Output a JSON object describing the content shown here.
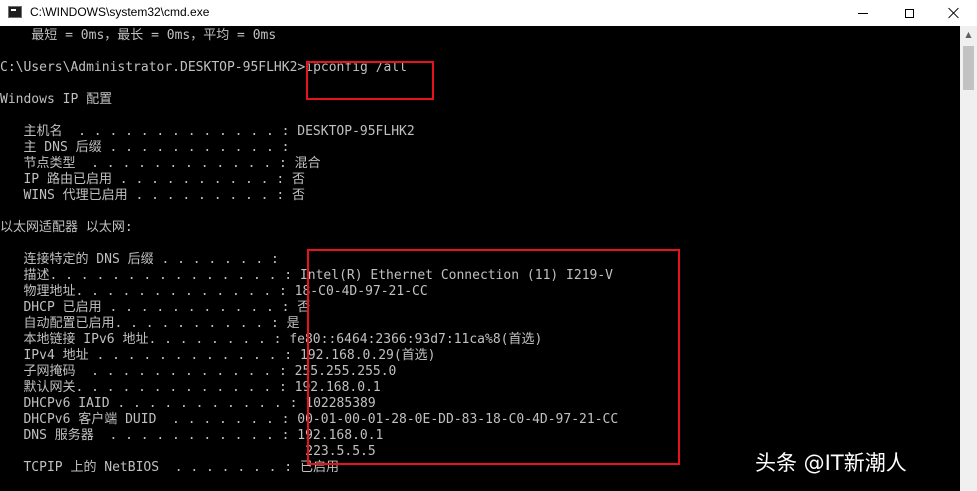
{
  "window": {
    "title": "C:\\WINDOWS\\system32\\cmd.exe",
    "icon": "cmd-icon",
    "controls": [
      "minimize-icon",
      "maximize-icon",
      "close-icon"
    ]
  },
  "console": {
    "ping_summary": "    最短 = 0ms，最长 = 0ms，平均 = 0ms",
    "prompt": "C:\\Users\\Administrator.DESKTOP-95FLHK2>",
    "command": "ipconfig /all",
    "section_ip": "Windows IP 配置",
    "ip_config": [
      {
        "label": "   主机名  . . . . . . . . . . . . . : ",
        "value": "DESKTOP-95FLHK2"
      },
      {
        "label": "   主 DNS 后缀 . . . . . . . . . . . : ",
        "value": ""
      },
      {
        "label": "   节点类型  . . . . . . . . . . . . : ",
        "value": "混合"
      },
      {
        "label": "   IP 路由已启用 . . . . . . . . . . : ",
        "value": "否"
      },
      {
        "label": "   WINS 代理已启用 . . . . . . . . . : ",
        "value": "否"
      }
    ],
    "section_adapter": "以太网适配器 以太网:",
    "adapter": [
      {
        "label": "   连接特定的 DNS 后缀 . . . . . . . : ",
        "value": ""
      },
      {
        "label": "   描述. . . . . . . . . . . . . . . : ",
        "value": "Intel(R) Ethernet Connection (11) I219-V"
      },
      {
        "label": "   物理地址. . . . . . . . . . . . . : ",
        "value": "18-C0-4D-97-21-CC"
      },
      {
        "label": "   DHCP 已启用 . . . . . . . . . . . : ",
        "value": "否"
      },
      {
        "label": "   自动配置已启用. . . . . . . . . . : ",
        "value": "是"
      },
      {
        "label": "   本地链接 IPv6 地址. . . . . . . . : ",
        "value": "fe80::6464:2366:93d7:11ca%8(首选)"
      },
      {
        "label": "   IPv4 地址 . . . . . . . . . . . . : ",
        "value": "192.168.0.29(首选)"
      },
      {
        "label": "   子网掩码  . . . . . . . . . . . . : ",
        "value": "255.255.255.0"
      },
      {
        "label": "   默认网关. . . . . . . . . . . . . : ",
        "value": "192.168.0.1"
      },
      {
        "label": "   DHCPv6 IAID . . . . . . . . . . . : ",
        "value": "102285389"
      },
      {
        "label": "   DHCPv6 客户端 DUID  . . . . . . . : ",
        "value": "00-01-00-01-28-0E-DD-83-18-C0-4D-97-21-CC"
      },
      {
        "label": "   DNS 服务器  . . . . . . . . . . . : ",
        "value": "192.168.0.1"
      },
      {
        "label": "                                       ",
        "value": "223.5.5.5"
      },
      {
        "label": "   TCPIP 上的 NetBIOS  . . . . . . . : ",
        "value": "已启用"
      }
    ]
  },
  "colors": {
    "console_bg": "#000000",
    "console_text": "#c0c0c0",
    "highlight": "#e8121b",
    "titlebar_bg": "#ffffff"
  },
  "watermark": "头条 @IT新潮人"
}
